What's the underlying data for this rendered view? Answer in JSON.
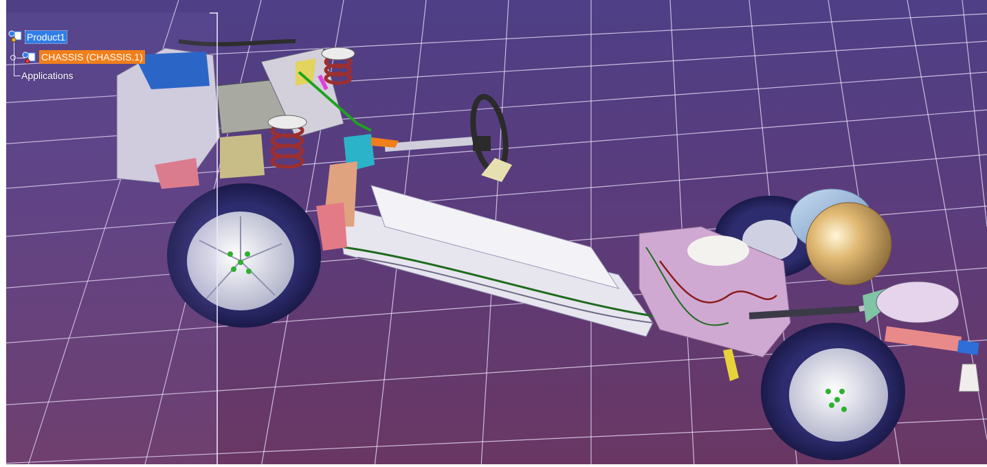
{
  "tree": {
    "root": {
      "label": "Product1",
      "icon": "product-assembly-icon",
      "selected": true
    },
    "children": [
      {
        "label": "CHASSIS (CHASSIS.1)",
        "icon": "part-assembly-icon",
        "highlighted": true
      }
    ],
    "footer": {
      "label": "Applications"
    }
  },
  "viewport": {
    "background_top": "#4e3f86",
    "background_bottom": "#6a3763",
    "grid_color": "#f2eaff",
    "model": "vehicle-chassis-3d-model"
  },
  "colors": {
    "selection_blue": "#2f7ee8",
    "highlight_orange": "#f07f1a"
  }
}
